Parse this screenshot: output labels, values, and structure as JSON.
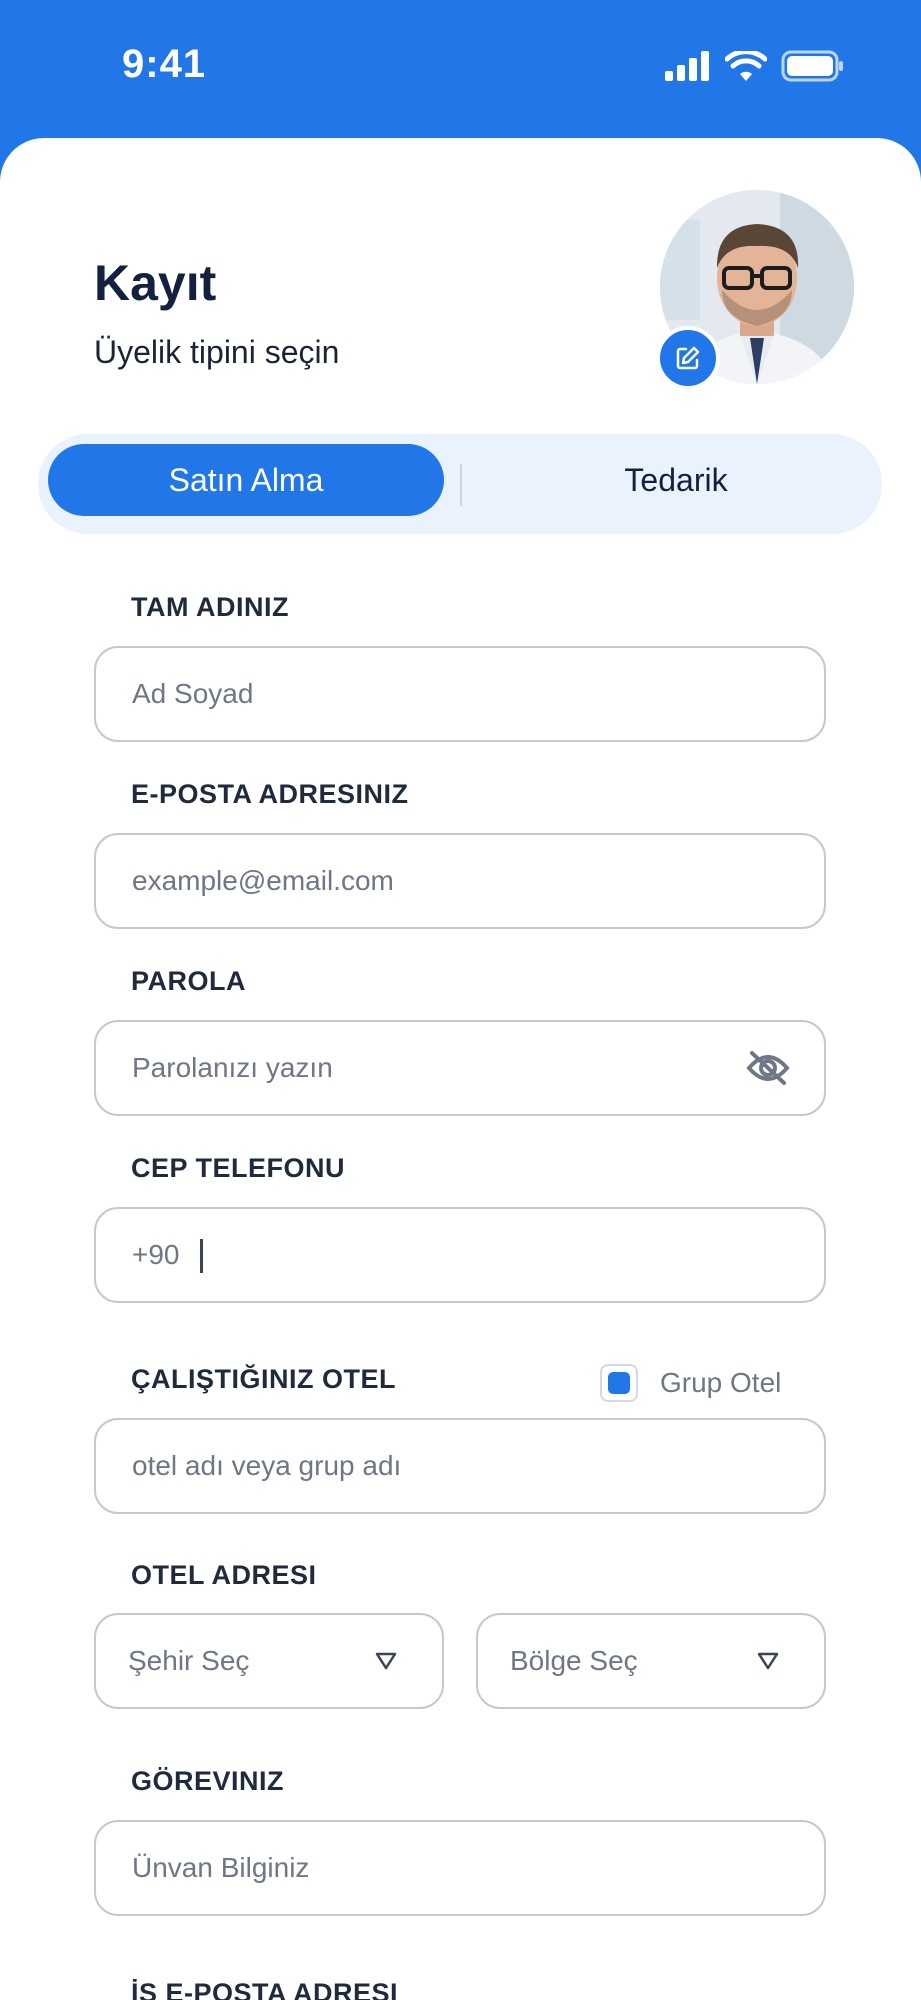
{
  "status_bar": {
    "time": "9:41"
  },
  "header": {
    "title": "Kayıt",
    "subtitle": "Üyelik tipini seçin"
  },
  "segment": {
    "options": [
      "Satın Alma",
      "Tedarik"
    ],
    "selected": "Satın Alma"
  },
  "form": {
    "full_name": {
      "label": "TAM ADINIZ",
      "placeholder": "Ad Soyad"
    },
    "email": {
      "label": "E-POSTA ADRESINIZ",
      "placeholder": "example@email.com"
    },
    "password": {
      "label": "PAROLA",
      "placeholder": "Parolanızı yazın",
      "toggle_icon": "eye-off-icon"
    },
    "phone": {
      "label": "CEP TELEFONU",
      "prefix": "+90",
      "value": ""
    },
    "hotel": {
      "label": "ÇALIŞTIĞINIZ OTEL",
      "placeholder": "otel adı veya grup adı",
      "group_checkbox_label": "Grup Otel",
      "group_checked": true
    },
    "address": {
      "label": "OTEL ADRESI",
      "city_placeholder": "Şehir Seç",
      "region_placeholder": "Bölge Seç"
    },
    "position": {
      "label": "GÖREVINIZ",
      "placeholder": "Ünvan Bilginiz"
    },
    "work_email": {
      "label": "İŞ E-POSTA ADRESI"
    }
  },
  "colors": {
    "accent": "#2176E8",
    "segment_bg": "#EAF2FD",
    "border": "#C5C8CF",
    "title": "#13213F"
  }
}
